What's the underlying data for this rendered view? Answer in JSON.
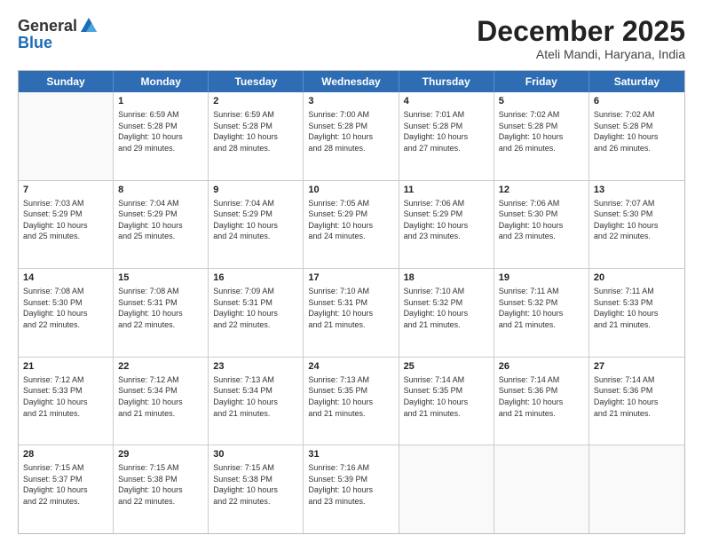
{
  "logo": {
    "general": "General",
    "blue": "Blue"
  },
  "header": {
    "month": "December 2025",
    "location": "Ateli Mandi, Haryana, India"
  },
  "weekdays": [
    "Sunday",
    "Monday",
    "Tuesday",
    "Wednesday",
    "Thursday",
    "Friday",
    "Saturday"
  ],
  "rows": [
    [
      {
        "day": "",
        "info": ""
      },
      {
        "day": "1",
        "info": "Sunrise: 6:59 AM\nSunset: 5:28 PM\nDaylight: 10 hours\nand 29 minutes."
      },
      {
        "day": "2",
        "info": "Sunrise: 6:59 AM\nSunset: 5:28 PM\nDaylight: 10 hours\nand 28 minutes."
      },
      {
        "day": "3",
        "info": "Sunrise: 7:00 AM\nSunset: 5:28 PM\nDaylight: 10 hours\nand 28 minutes."
      },
      {
        "day": "4",
        "info": "Sunrise: 7:01 AM\nSunset: 5:28 PM\nDaylight: 10 hours\nand 27 minutes."
      },
      {
        "day": "5",
        "info": "Sunrise: 7:02 AM\nSunset: 5:28 PM\nDaylight: 10 hours\nand 26 minutes."
      },
      {
        "day": "6",
        "info": "Sunrise: 7:02 AM\nSunset: 5:28 PM\nDaylight: 10 hours\nand 26 minutes."
      }
    ],
    [
      {
        "day": "7",
        "info": "Sunrise: 7:03 AM\nSunset: 5:29 PM\nDaylight: 10 hours\nand 25 minutes."
      },
      {
        "day": "8",
        "info": "Sunrise: 7:04 AM\nSunset: 5:29 PM\nDaylight: 10 hours\nand 25 minutes."
      },
      {
        "day": "9",
        "info": "Sunrise: 7:04 AM\nSunset: 5:29 PM\nDaylight: 10 hours\nand 24 minutes."
      },
      {
        "day": "10",
        "info": "Sunrise: 7:05 AM\nSunset: 5:29 PM\nDaylight: 10 hours\nand 24 minutes."
      },
      {
        "day": "11",
        "info": "Sunrise: 7:06 AM\nSunset: 5:29 PM\nDaylight: 10 hours\nand 23 minutes."
      },
      {
        "day": "12",
        "info": "Sunrise: 7:06 AM\nSunset: 5:30 PM\nDaylight: 10 hours\nand 23 minutes."
      },
      {
        "day": "13",
        "info": "Sunrise: 7:07 AM\nSunset: 5:30 PM\nDaylight: 10 hours\nand 22 minutes."
      }
    ],
    [
      {
        "day": "14",
        "info": "Sunrise: 7:08 AM\nSunset: 5:30 PM\nDaylight: 10 hours\nand 22 minutes."
      },
      {
        "day": "15",
        "info": "Sunrise: 7:08 AM\nSunset: 5:31 PM\nDaylight: 10 hours\nand 22 minutes."
      },
      {
        "day": "16",
        "info": "Sunrise: 7:09 AM\nSunset: 5:31 PM\nDaylight: 10 hours\nand 22 minutes."
      },
      {
        "day": "17",
        "info": "Sunrise: 7:10 AM\nSunset: 5:31 PM\nDaylight: 10 hours\nand 21 minutes."
      },
      {
        "day": "18",
        "info": "Sunrise: 7:10 AM\nSunset: 5:32 PM\nDaylight: 10 hours\nand 21 minutes."
      },
      {
        "day": "19",
        "info": "Sunrise: 7:11 AM\nSunset: 5:32 PM\nDaylight: 10 hours\nand 21 minutes."
      },
      {
        "day": "20",
        "info": "Sunrise: 7:11 AM\nSunset: 5:33 PM\nDaylight: 10 hours\nand 21 minutes."
      }
    ],
    [
      {
        "day": "21",
        "info": "Sunrise: 7:12 AM\nSunset: 5:33 PM\nDaylight: 10 hours\nand 21 minutes."
      },
      {
        "day": "22",
        "info": "Sunrise: 7:12 AM\nSunset: 5:34 PM\nDaylight: 10 hours\nand 21 minutes."
      },
      {
        "day": "23",
        "info": "Sunrise: 7:13 AM\nSunset: 5:34 PM\nDaylight: 10 hours\nand 21 minutes."
      },
      {
        "day": "24",
        "info": "Sunrise: 7:13 AM\nSunset: 5:35 PM\nDaylight: 10 hours\nand 21 minutes."
      },
      {
        "day": "25",
        "info": "Sunrise: 7:14 AM\nSunset: 5:35 PM\nDaylight: 10 hours\nand 21 minutes."
      },
      {
        "day": "26",
        "info": "Sunrise: 7:14 AM\nSunset: 5:36 PM\nDaylight: 10 hours\nand 21 minutes."
      },
      {
        "day": "27",
        "info": "Sunrise: 7:14 AM\nSunset: 5:36 PM\nDaylight: 10 hours\nand 21 minutes."
      }
    ],
    [
      {
        "day": "28",
        "info": "Sunrise: 7:15 AM\nSunset: 5:37 PM\nDaylight: 10 hours\nand 22 minutes."
      },
      {
        "day": "29",
        "info": "Sunrise: 7:15 AM\nSunset: 5:38 PM\nDaylight: 10 hours\nand 22 minutes."
      },
      {
        "day": "30",
        "info": "Sunrise: 7:15 AM\nSunset: 5:38 PM\nDaylight: 10 hours\nand 22 minutes."
      },
      {
        "day": "31",
        "info": "Sunrise: 7:16 AM\nSunset: 5:39 PM\nDaylight: 10 hours\nand 23 minutes."
      },
      {
        "day": "",
        "info": ""
      },
      {
        "day": "",
        "info": ""
      },
      {
        "day": "",
        "info": ""
      }
    ]
  ]
}
